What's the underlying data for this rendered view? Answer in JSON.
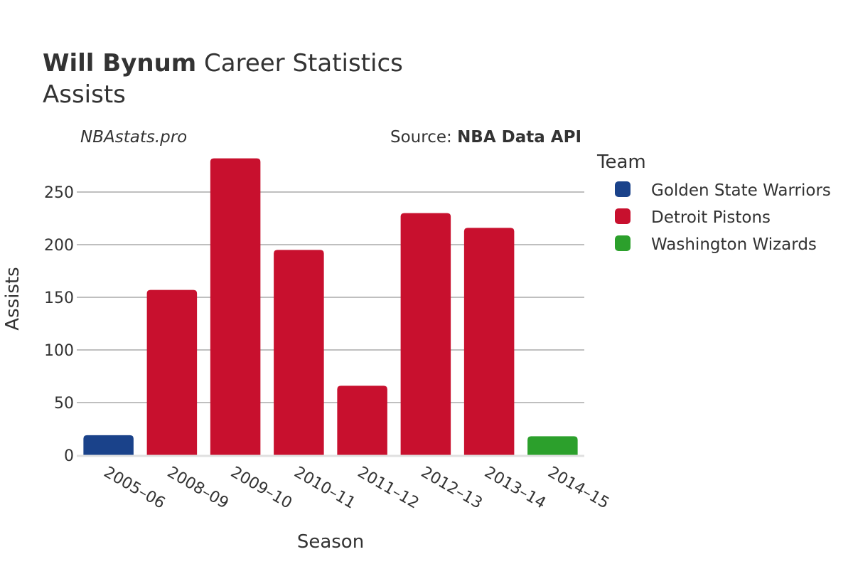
{
  "title": {
    "bold": "Will Bynum",
    "rest": " Career Statistics",
    "subtitle": "Assists"
  },
  "brand": "NBAstats.pro",
  "source": {
    "prefix": "Source: ",
    "name": "NBA Data API"
  },
  "legend": {
    "title": "Team",
    "items": [
      {
        "label": "Golden State Warriors",
        "color": "#1a428a"
      },
      {
        "label": "Detroit Pistons",
        "color": "#c8102e"
      },
      {
        "label": "Washington Wizards",
        "color": "#2ca02c"
      }
    ]
  },
  "chart_data": {
    "type": "bar",
    "title": "Will Bynum Career Statistics",
    "subtitle": "Assists",
    "xlabel": "Season",
    "ylabel": "Assists",
    "ylim": [
      0,
      290
    ],
    "yticks": [
      0,
      50,
      100,
      150,
      200,
      250
    ],
    "grid": true,
    "legend_placement": "right",
    "categories": [
      "2005–06",
      "2008–09",
      "2009–10",
      "2010–11",
      "2011–12",
      "2012–13",
      "2013–14",
      "2014–15"
    ],
    "values": [
      19,
      157,
      282,
      195,
      66,
      230,
      216,
      18
    ],
    "teams": [
      "Golden State Warriors",
      "Detroit Pistons",
      "Detroit Pistons",
      "Detroit Pistons",
      "Detroit Pistons",
      "Detroit Pistons",
      "Detroit Pistons",
      "Washington Wizards"
    ],
    "series": [
      {
        "name": "Golden State Warriors",
        "color": "#1a428a",
        "values": [
          19,
          null,
          null,
          null,
          null,
          null,
          null,
          null
        ]
      },
      {
        "name": "Detroit Pistons",
        "color": "#c8102e",
        "values": [
          null,
          157,
          282,
          195,
          66,
          230,
          216,
          null
        ]
      },
      {
        "name": "Washington Wizards",
        "color": "#2ca02c",
        "values": [
          null,
          null,
          null,
          null,
          null,
          null,
          null,
          18
        ]
      }
    ]
  }
}
